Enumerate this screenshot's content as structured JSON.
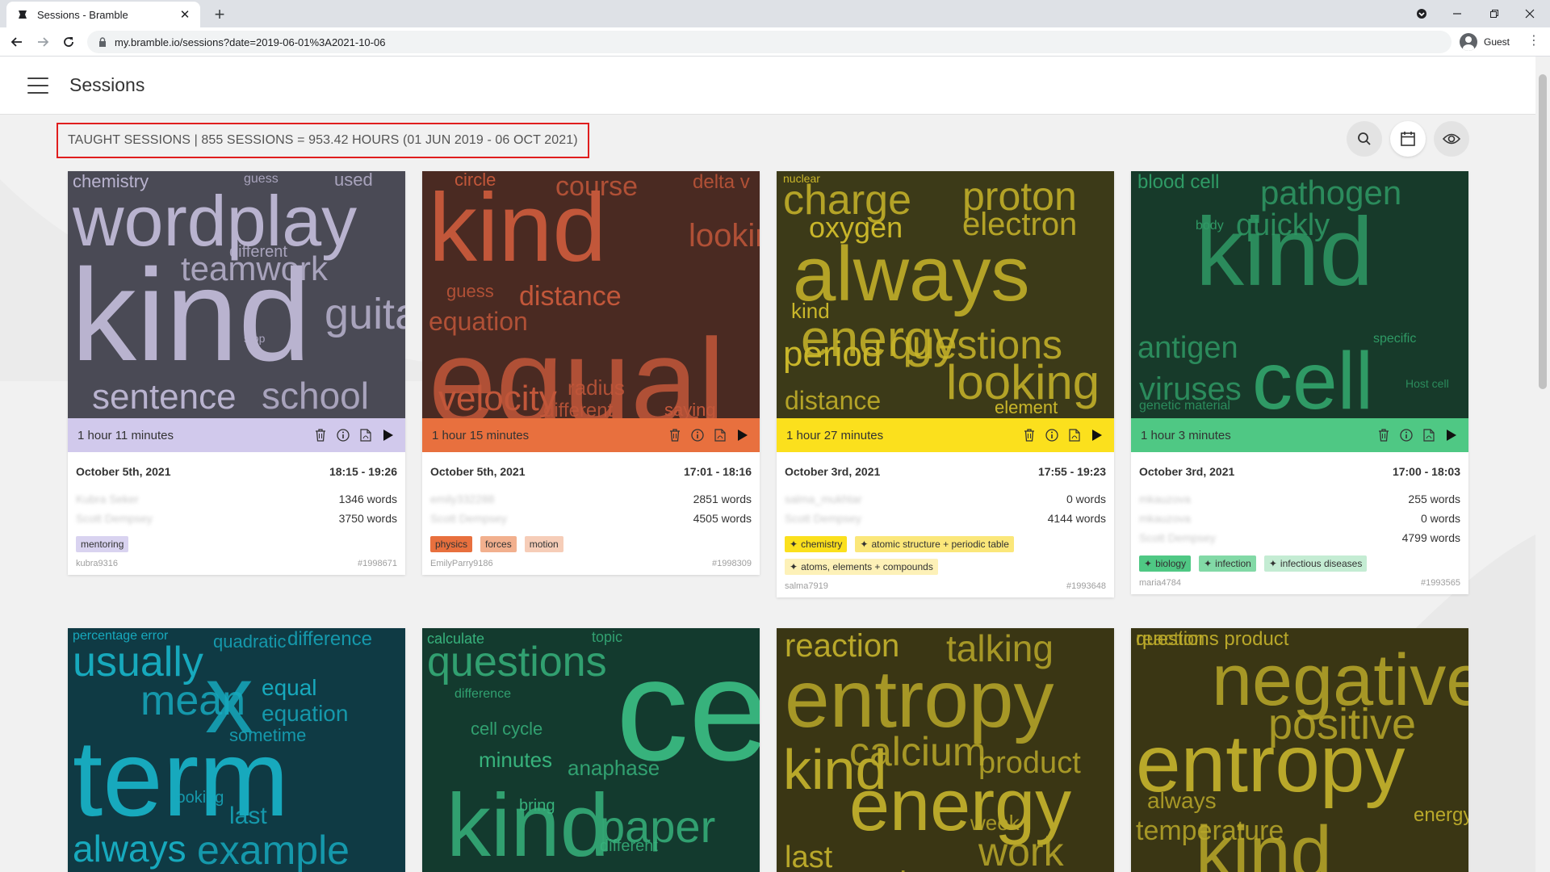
{
  "browser": {
    "tab_title": "Sessions - Bramble",
    "new_tab": "+",
    "url": "my.bramble.io/sessions?date=2019-06-01%3A2021-10-06",
    "profile": "Guest"
  },
  "app": {
    "title": "Sessions",
    "summary": "TAUGHT SESSIONS | 855 SESSIONS = 953.42 HOURS (01 JUN 2019 - 06 OCT 2021)"
  },
  "cards": [
    {
      "color": "#d1c9ec",
      "cloud_bg": "#4a4a55",
      "word_color": "#b9b3cf",
      "words": [
        "chemistry",
        "guess",
        "used",
        "wordplay",
        "teamwork",
        "different",
        "kind",
        "guitar",
        "stop",
        "sentence",
        "school"
      ],
      "duration": "1 hour 11 minutes",
      "date": "October 5th, 2021",
      "time": "18:15 - 19:26",
      "people": [
        {
          "name": "Kubra Seker",
          "words": "1346 words"
        },
        {
          "name": "Scott Dempsey",
          "words": "3750 words"
        }
      ],
      "tags": [
        {
          "label": "mentoring",
          "bg": "#d9d3f0"
        }
      ],
      "user": "kubra9316",
      "id": "#1998671"
    },
    {
      "color": "#e8703e",
      "cloud_bg": "#4a2a22",
      "word_color": "#c2573a",
      "words": [
        "circle",
        "course",
        "delta v",
        "kind",
        "guess",
        "equation",
        "distance",
        "looking",
        "equal",
        "velocity",
        "radius",
        "different",
        "saying"
      ],
      "duration": "1 hour 15 minutes",
      "date": "October 5th, 2021",
      "time": "17:01 - 18:16",
      "people": [
        {
          "name": "emily332288",
          "words": "2851 words"
        },
        {
          "name": "Scott Dempsey",
          "words": "4505 words"
        }
      ],
      "tags": [
        {
          "label": "physics",
          "bg": "#e8703e"
        },
        {
          "label": "forces",
          "bg": "#f2b08e"
        },
        {
          "label": "motion",
          "bg": "#f6cdb8"
        }
      ],
      "user": "EmilyParry9186",
      "id": "#1998309"
    },
    {
      "color": "#fbe01d",
      "cloud_bg": "#3c3a18",
      "word_color": "#c9b62a",
      "words": [
        "nuclear",
        "charge",
        "proton",
        "oxygen",
        "electron",
        "always",
        "kind",
        "energy",
        "questions",
        "period",
        "looking",
        "distance",
        "element"
      ],
      "duration": "1 hour 27 minutes",
      "date": "October 3rd, 2021",
      "time": "17:55 - 19:23",
      "people": [
        {
          "name": "salma_mukhtar",
          "words": "0 words"
        },
        {
          "name": "Scott Dempsey",
          "words": "4144 words"
        }
      ],
      "tags": [
        {
          "label": "chemistry",
          "bg": "#fbe01d"
        },
        {
          "label": "atomic structure + periodic table",
          "bg": "#fbe77a"
        },
        {
          "label": "atoms, elements + compounds",
          "bg": "#fdf1b8"
        }
      ],
      "user": "salma7919",
      "id": "#1993648"
    },
    {
      "color": "#4fc884",
      "cloud_bg": "#173a2a",
      "word_color": "#2f9a65",
      "words": [
        "blood cell",
        "pathogen",
        "quickly",
        "body",
        "kind",
        "antigen",
        "cell",
        "viruses",
        "genetic material",
        "specific",
        "Host cell"
      ],
      "duration": "1 hour 3 minutes",
      "date": "October 3rd, 2021",
      "time": "17:00 - 18:03",
      "people": [
        {
          "name": "mkauzova",
          "words": "255 words"
        },
        {
          "name": "mkauzova",
          "words": "0 words"
        },
        {
          "name": "Scott Dempsey",
          "words": "4799 words"
        }
      ],
      "tags": [
        {
          "label": "biology",
          "bg": "#4fc884"
        },
        {
          "label": "infection",
          "bg": "#82d9a6"
        },
        {
          "label": "infectious diseases",
          "bg": "#c4ecd3"
        }
      ],
      "user": "maria4784",
      "id": "#1993565"
    },
    {
      "color": "#1bb3c4",
      "cloud_bg": "#0f3a44",
      "word_color": "#17a9bd",
      "words": [
        "percentage error",
        "quadratic",
        "difference",
        "usually",
        "mean",
        "x",
        "equal",
        "equation",
        "sometime",
        "term",
        "looking",
        "last",
        "always",
        "example"
      ],
      "duration": "",
      "date": "",
      "time": "",
      "people": [],
      "tags": [],
      "user": "",
      "id": ""
    },
    {
      "color": "#3fc28a",
      "cloud_bg": "#133a2e",
      "word_color": "#37b27c",
      "words": [
        "calculate",
        "topic",
        "questions",
        "cell",
        "cell cycle",
        "difference",
        "minutes",
        "anaphase",
        "kind",
        "bring",
        "paper",
        "different"
      ],
      "duration": "",
      "date": "",
      "time": "",
      "people": [],
      "tags": [],
      "user": "",
      "id": ""
    },
    {
      "color": "#d4c22e",
      "cloud_bg": "#3a3614",
      "word_color": "#b9a82a",
      "words": [
        "reaction",
        "talking",
        "entropy",
        "kind",
        "calcium",
        "product",
        "energy",
        "week",
        "work",
        "last",
        "magnesium"
      ],
      "duration": "",
      "date": "",
      "time": "",
      "people": [],
      "tags": [],
      "user": "",
      "id": ""
    },
    {
      "color": "#d4c22e",
      "cloud_bg": "#3a3614",
      "word_color": "#b9a82a",
      "words": [
        "questions product",
        "negative",
        "positive",
        "entropy",
        "always",
        "temperature",
        "energy",
        "kind",
        "reaction"
      ],
      "duration": "",
      "date": "",
      "time": "",
      "people": [],
      "tags": [],
      "user": "",
      "id": ""
    }
  ]
}
